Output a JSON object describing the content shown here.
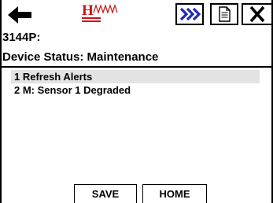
{
  "toolbar": {
    "back_icon": "left-arrow-icon",
    "logo_icon": "hw-logo-icon",
    "next_icon": "triple-chevron-right-icon",
    "doc_icon": "document-icon",
    "close_icon": "close-icon",
    "accent_color": "#1f2bb5",
    "logo_color": "#c81414"
  },
  "device": {
    "tag": "3144P:",
    "status_title": "Device Status: Maintenance"
  },
  "list": {
    "items": [
      {
        "label": "1 Refresh Alerts",
        "selected": true
      },
      {
        "label": "2 M: Sensor 1 Degraded",
        "selected": false
      }
    ]
  },
  "bottom": {
    "save_label": "SAVE",
    "home_label": "HOME"
  }
}
